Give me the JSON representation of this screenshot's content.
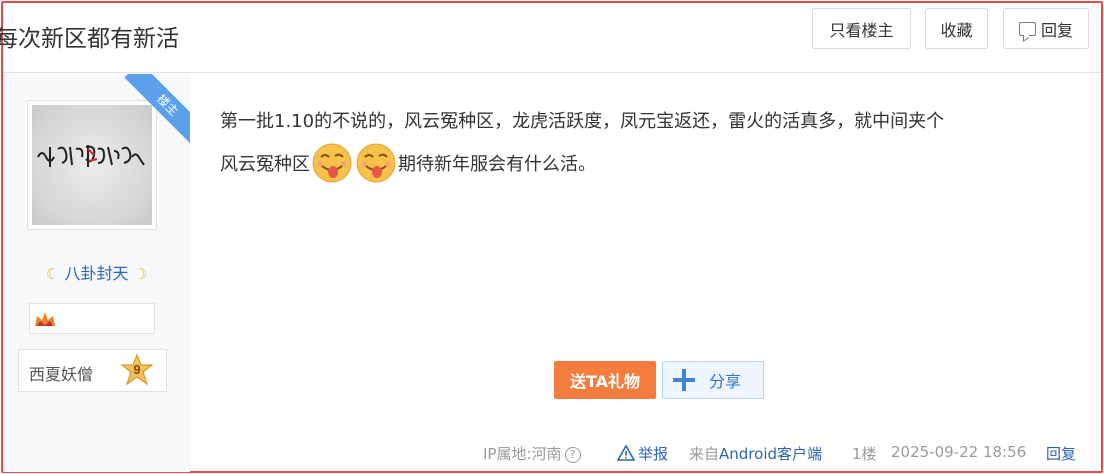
{
  "post": {
    "title": "每次新区都有新活",
    "actions": {
      "only_owner": "只看楼主",
      "favorite": "收藏",
      "reply": "回复"
    }
  },
  "author": {
    "ribbon": "楼主",
    "name": "八卦封天",
    "level_title": "西夏妖僧",
    "level": "9",
    "avatar_icon": "avatar-handwriting-image"
  },
  "content": {
    "line1": "第一批1.10的不说的，风云冤种区，龙虎活跃度，凤元宝返还，雷火的活真多，就中间夹个",
    "line2_before": "风云冤种区",
    "line2_after": "期待新年服会有什么活。"
  },
  "buttons": {
    "gift": "送TA礼物",
    "share": "分享"
  },
  "meta": {
    "ip": "IP属地:河南",
    "help": "?",
    "report": "举报",
    "from_prefix": "来自",
    "client": "Android客户端",
    "floor": "1楼",
    "time": "2025-09-22 18:56",
    "reply": "回复"
  },
  "colors": {
    "frame_border": "#e84a4a",
    "link_blue": "#2d64b3",
    "gift_orange": "#f47c3c",
    "ribbon_blue": "#5aa0ea"
  }
}
